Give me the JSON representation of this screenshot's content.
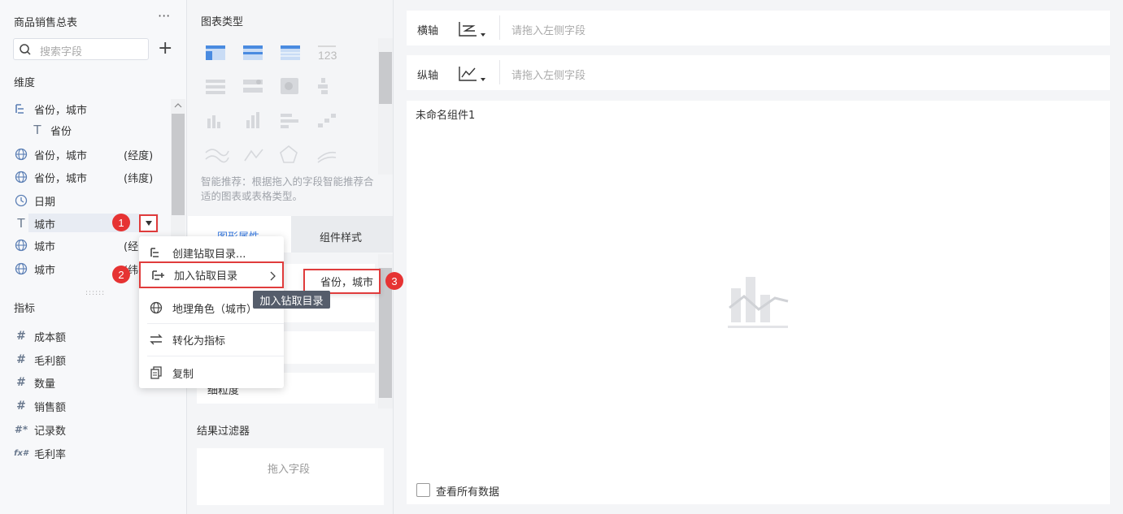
{
  "left": {
    "title": "商品销售总表",
    "more": "···",
    "search_placeholder": "搜索字段",
    "add": "+",
    "dimensions_label": "维度",
    "dimensions": [
      {
        "icon": "hierarchy-icon",
        "label": "省份，城市",
        "ext": ""
      },
      {
        "icon": "text-icon",
        "label": "省份",
        "ext": ""
      },
      {
        "icon": "globe-icon",
        "label": "省份，城市",
        "ext": "(经度)"
      },
      {
        "icon": "globe-icon",
        "label": "省份，城市",
        "ext": "(纬度)"
      },
      {
        "icon": "clock-icon",
        "label": "日期",
        "ext": ""
      },
      {
        "icon": "text-icon",
        "label": "城市",
        "ext": ""
      },
      {
        "icon": "globe-icon",
        "label": "城市",
        "ext": "(经"
      },
      {
        "icon": "globe-icon",
        "label": "城市",
        "ext": "(纬"
      }
    ],
    "measures_label": "指标",
    "measures": [
      {
        "icon": "#",
        "label": "成本额"
      },
      {
        "icon": "#",
        "label": "毛利额"
      },
      {
        "icon": "#",
        "label": "数量"
      },
      {
        "icon": "#",
        "label": "销售额"
      },
      {
        "icon": "#*",
        "label": "记录数"
      },
      {
        "icon": "fx#",
        "label": "毛利率"
      }
    ]
  },
  "middle": {
    "chart_types_title": "图表类型",
    "smart_tip": "智能推荐：根据拖入的字段智能推荐合适的图表或表格类型。",
    "tab_active": "图形属性",
    "tab_other": "组件样式",
    "prop_last": "细粒度",
    "filter_title": "结果过滤器",
    "filter_placeholder": "拖入字段"
  },
  "right": {
    "x_axis_label": "横轴",
    "y_axis_label": "纵轴",
    "axis_placeholder": "请拖入左侧字段",
    "component_title": "未命名组件1",
    "view_all": "查看所有数据"
  },
  "menu": {
    "items": [
      "创建钻取目录...",
      "加入钻取目录",
      "地理角色（城市）",
      "转化为指标",
      "复制"
    ],
    "submenu_item": "省份，城市",
    "tooltip": "加入钻取目录"
  },
  "badges": [
    "1",
    "2",
    "3"
  ],
  "colors": {
    "accent": "#3a7be0",
    "highlight": "#e03c3c",
    "badge": "#e63333",
    "measure_icon": "#27a68b"
  }
}
